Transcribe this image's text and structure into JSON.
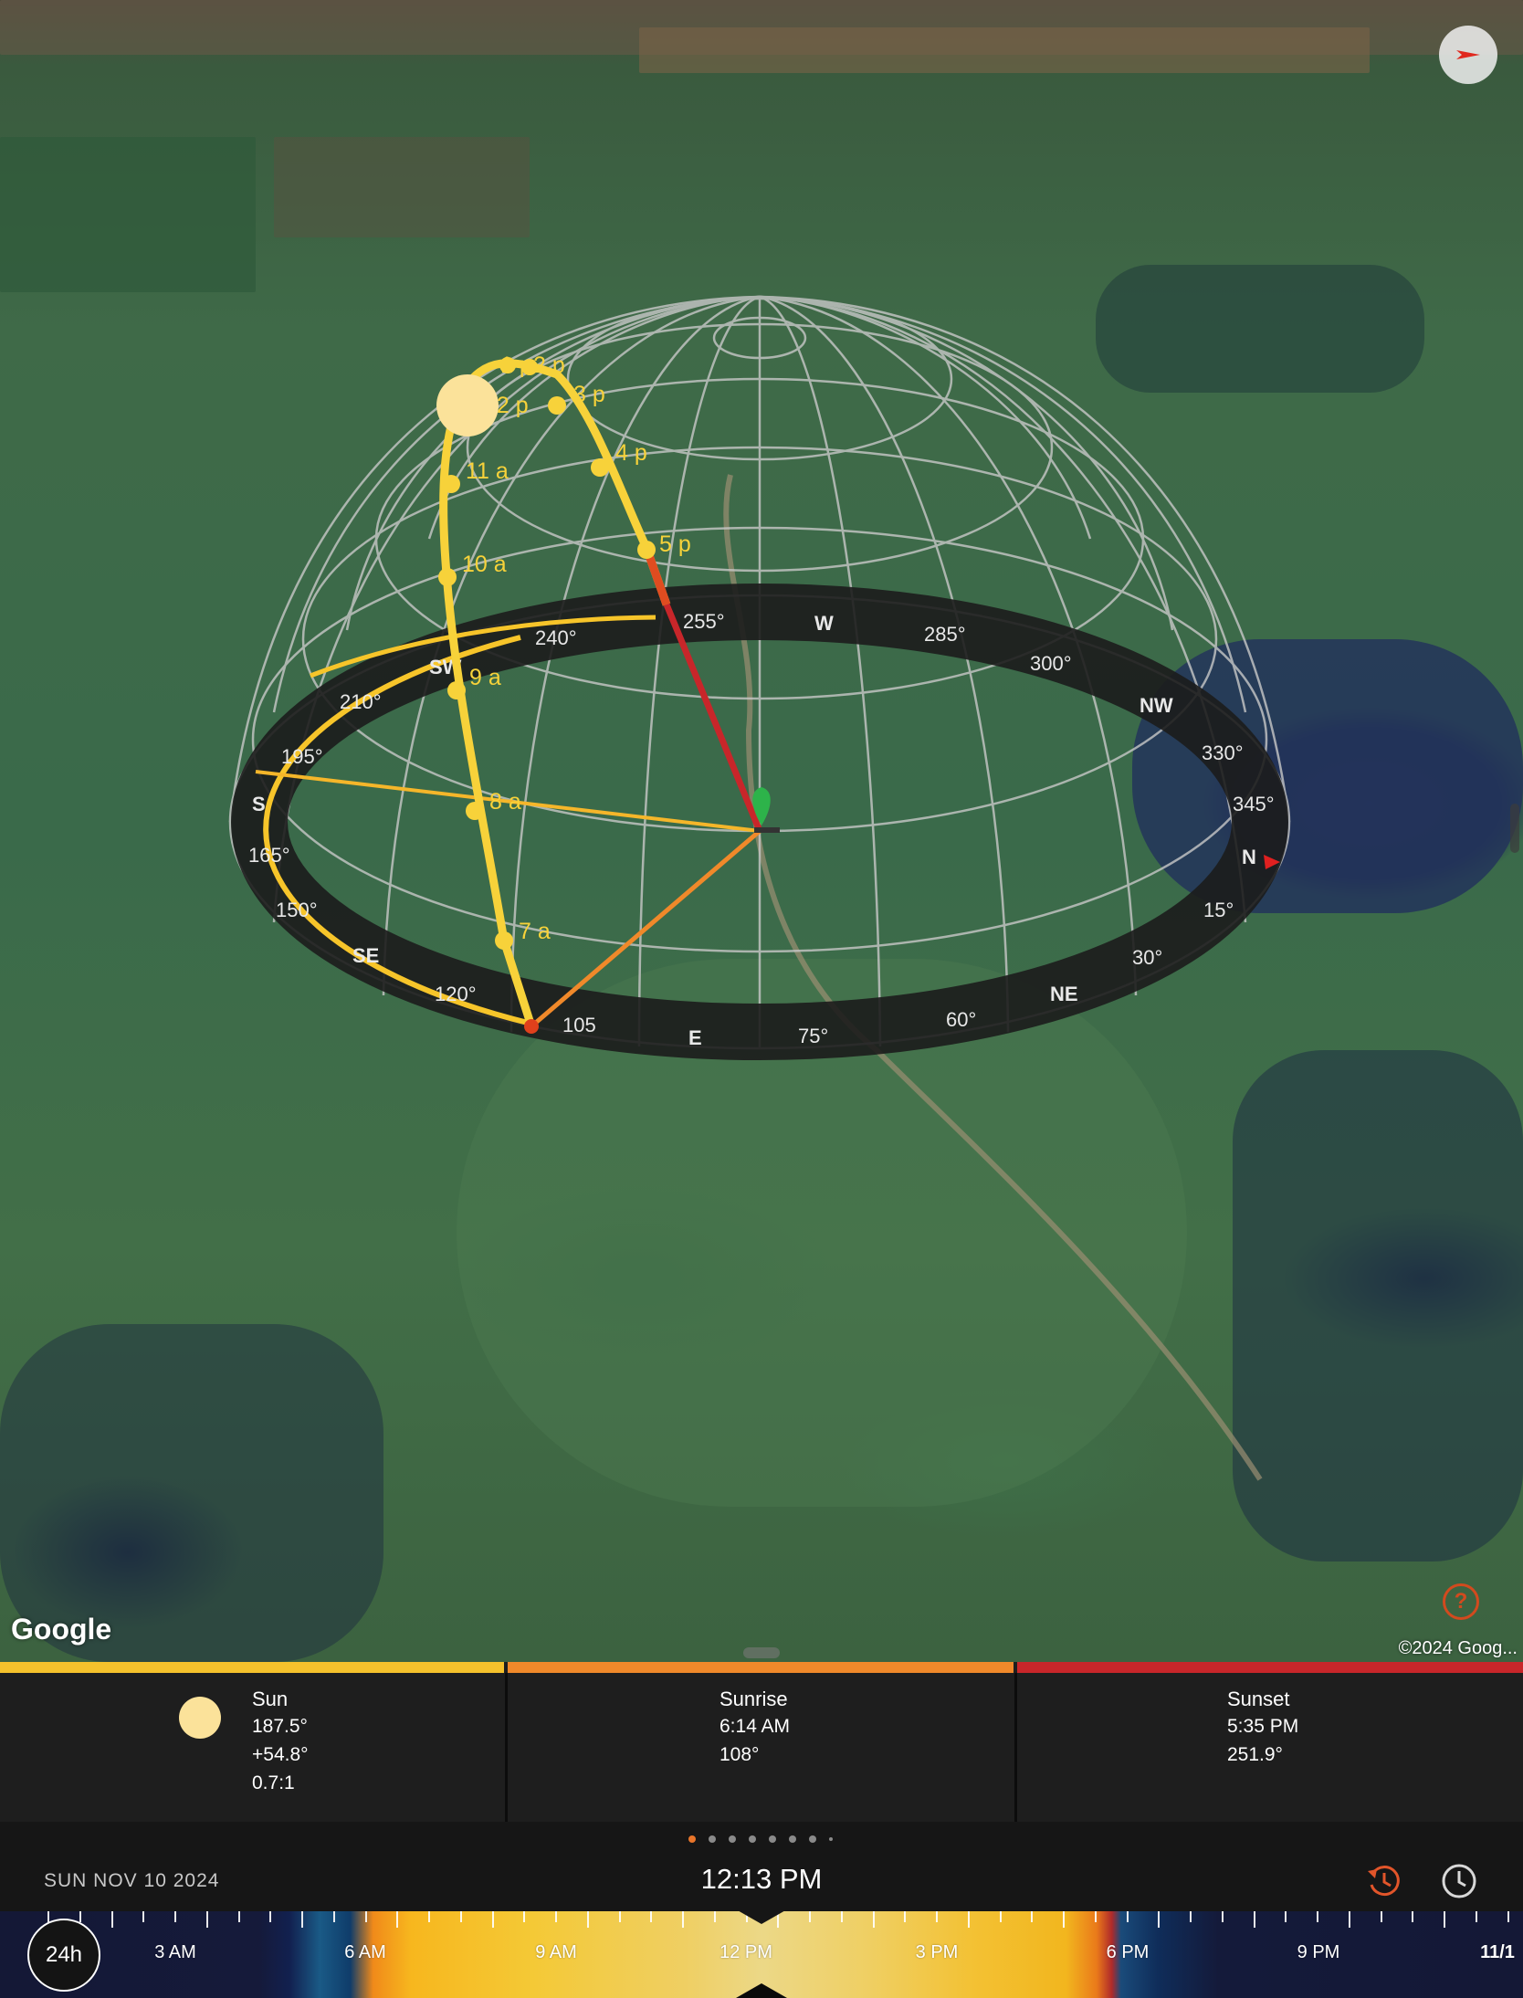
{
  "map": {
    "google_logo": "Google",
    "copyright": "©2024 Goog...",
    "direction_button_icon": "navigation-arrow-icon",
    "help_button_icon": "question-icon",
    "help_label": "?",
    "hour_labels": [
      "1 p",
      "2 p",
      "12 p",
      "3 p",
      "4 p",
      "11 a",
      "5 p",
      "10 a",
      "9 a",
      "8 a",
      "7 a"
    ],
    "compass_labels": [
      "255°",
      "W",
      "285°",
      "300°",
      "NW",
      "330°",
      "345°",
      "N",
      "15°",
      "30°",
      "NE",
      "60°",
      "75°",
      "E",
      "105",
      "120°",
      "SE",
      "150°",
      "165°",
      "S",
      "195°",
      "210°",
      "SW",
      "240°"
    ],
    "colors": {
      "sun_path": "#f7d23a",
      "sun": "#fbe29a",
      "sunrise_line": "#f0892a",
      "sunset_line": "#c8262a",
      "azimuth_line": "#f5b62a",
      "location_pin": "#2db34a"
    }
  },
  "info": {
    "sun": {
      "title": "Sun",
      "azimuth": "187.5°",
      "elevation": "+54.8°",
      "shadow_ratio": "0.7:1",
      "color": "#f5c22c"
    },
    "sunrise": {
      "title": "Sunrise",
      "time": "6:14 AM",
      "azimuth": "108°",
      "color": "#f0892a"
    },
    "sunset": {
      "title": "Sunset",
      "time": "5:35 PM",
      "azimuth": "251.9°",
      "color": "#c8262a"
    }
  },
  "time_bar": {
    "date": "SUN NOV 10 2024",
    "time": "12:13 PM",
    "reset_time_icon": "history-icon",
    "clock_icon": "clock-icon",
    "page_dots_count": 8,
    "active_page": 0
  },
  "timeline": {
    "toggle_label": "24h",
    "labels": [
      "3 AM",
      "6 AM",
      "9 AM",
      "12 PM",
      "3 PM",
      "6 PM",
      "9 PM",
      "11/1"
    ]
  }
}
